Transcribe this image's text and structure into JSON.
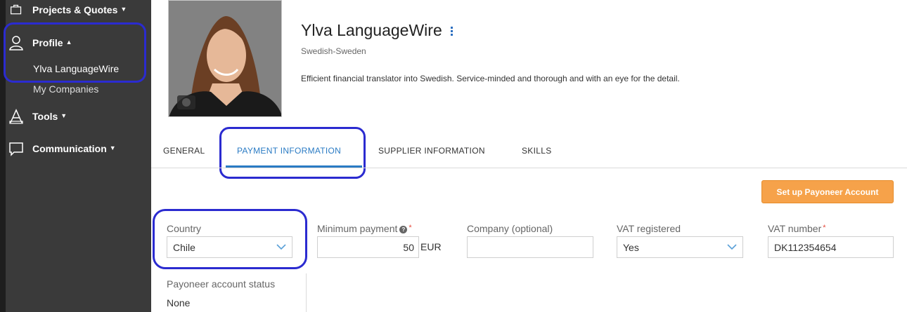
{
  "sidebar": {
    "projects_label": "Projects & Quotes",
    "profile_label": "Profile",
    "profile_sub_name": "Ylva LanguageWire",
    "profile_sub_companies": "My Companies",
    "tools_label": "Tools",
    "communication_label": "Communication"
  },
  "profile": {
    "name": "Ylva LanguageWire",
    "language": "Swedish-Sweden",
    "description": "Efficient financial translator into Swedish. Service-minded and thorough and with an eye for the detail."
  },
  "tabs": {
    "general": "GENERAL",
    "payment": "PAYMENT INFORMATION",
    "supplier": "SUPPLIER INFORMATION",
    "skills": "SKILLS"
  },
  "payoneer_button": "Set up Payoneer Account",
  "form": {
    "country_label": "Country",
    "country_value": "Chile",
    "min_payment_label": "Minimum payment",
    "min_payment_value": "50",
    "min_payment_currency": "EUR",
    "company_label": "Company (optional)",
    "company_value": "",
    "vat_registered_label": "VAT registered",
    "vat_registered_value": "Yes",
    "vat_number_label": "VAT number",
    "vat_number_value": "DK112354654",
    "required_mark": "*",
    "help_glyph": "?",
    "payoneer_status_label": "Payoneer account status",
    "payoneer_status_value": "None"
  },
  "colors": {
    "sidebar_bg": "#3a3a3a",
    "accent_blue": "#2a7bc4",
    "button_orange": "#f6a24a",
    "annotation_blue": "#2b2bd0"
  },
  "icons": [
    "briefcase-icon",
    "person-icon",
    "tools-icon",
    "chat-bubble-icon",
    "help-icon",
    "chevron-down-icon",
    "kebab-menu-icon",
    "camera-icon"
  ]
}
